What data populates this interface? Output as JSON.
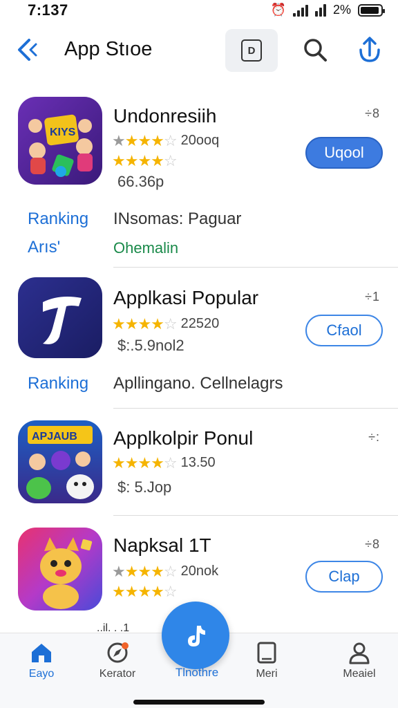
{
  "status": {
    "time": "7:137",
    "battery_text": "2%"
  },
  "nav": {
    "back_icon": "chevron-left-icon",
    "title": "App Stıoe",
    "doc_label": "D",
    "search_icon": "search-icon",
    "share_icon": "share-icon"
  },
  "apps": [
    {
      "name": "Undonresiih",
      "rating_count": "20ooq",
      "stars_row1": 4,
      "stars_row2": 4.5,
      "size": "66.36p",
      "more": "÷8",
      "action": "Uqool",
      "action_style": "filled",
      "rank_label_1": "Ranking",
      "rank_text_1": "INsomas: Paguar",
      "rank_label_2": "Arıs'",
      "rank_text_2": "Ohemalin"
    },
    {
      "name": "Applkasi Popular",
      "rating_count": "22520",
      "stars_row1": 4.5,
      "size": "$:.5.9nol2",
      "more": "÷1",
      "action": "Cfaol",
      "action_style": "outline",
      "rank_label_1": "Ranking",
      "rank_text_1": "Apllingano. Cellnelagrs"
    },
    {
      "name": "Applkolpir Ponul",
      "rating_count": "13.50",
      "stars_row1": 3.5,
      "size": "$: 5.Jop",
      "more": "÷:",
      "action": ""
    },
    {
      "name": "Napksal 1T",
      "rating_count": "20nok",
      "stars_row1": 4,
      "stars_row2": 4.5,
      "size": "",
      "more": "÷8",
      "action": "Clap",
      "action_style": "outline"
    }
  ],
  "tabbar": {
    "peek_text": "..il. . .1",
    "tabs": [
      {
        "label": "Eayo",
        "icon": "home-icon"
      },
      {
        "label": "Kerator",
        "icon": "compass-icon"
      },
      {
        "label": "Tlnothre",
        "icon": "tiktok-icon"
      },
      {
        "label": "Meri",
        "icon": "book-icon"
      },
      {
        "label": "Meaiel",
        "icon": "person-icon"
      }
    ]
  },
  "colors": {
    "accent": "#1d6fd6",
    "button_fill": "#3d7be0",
    "star": "#f5b400",
    "fab": "#2f86e8"
  }
}
